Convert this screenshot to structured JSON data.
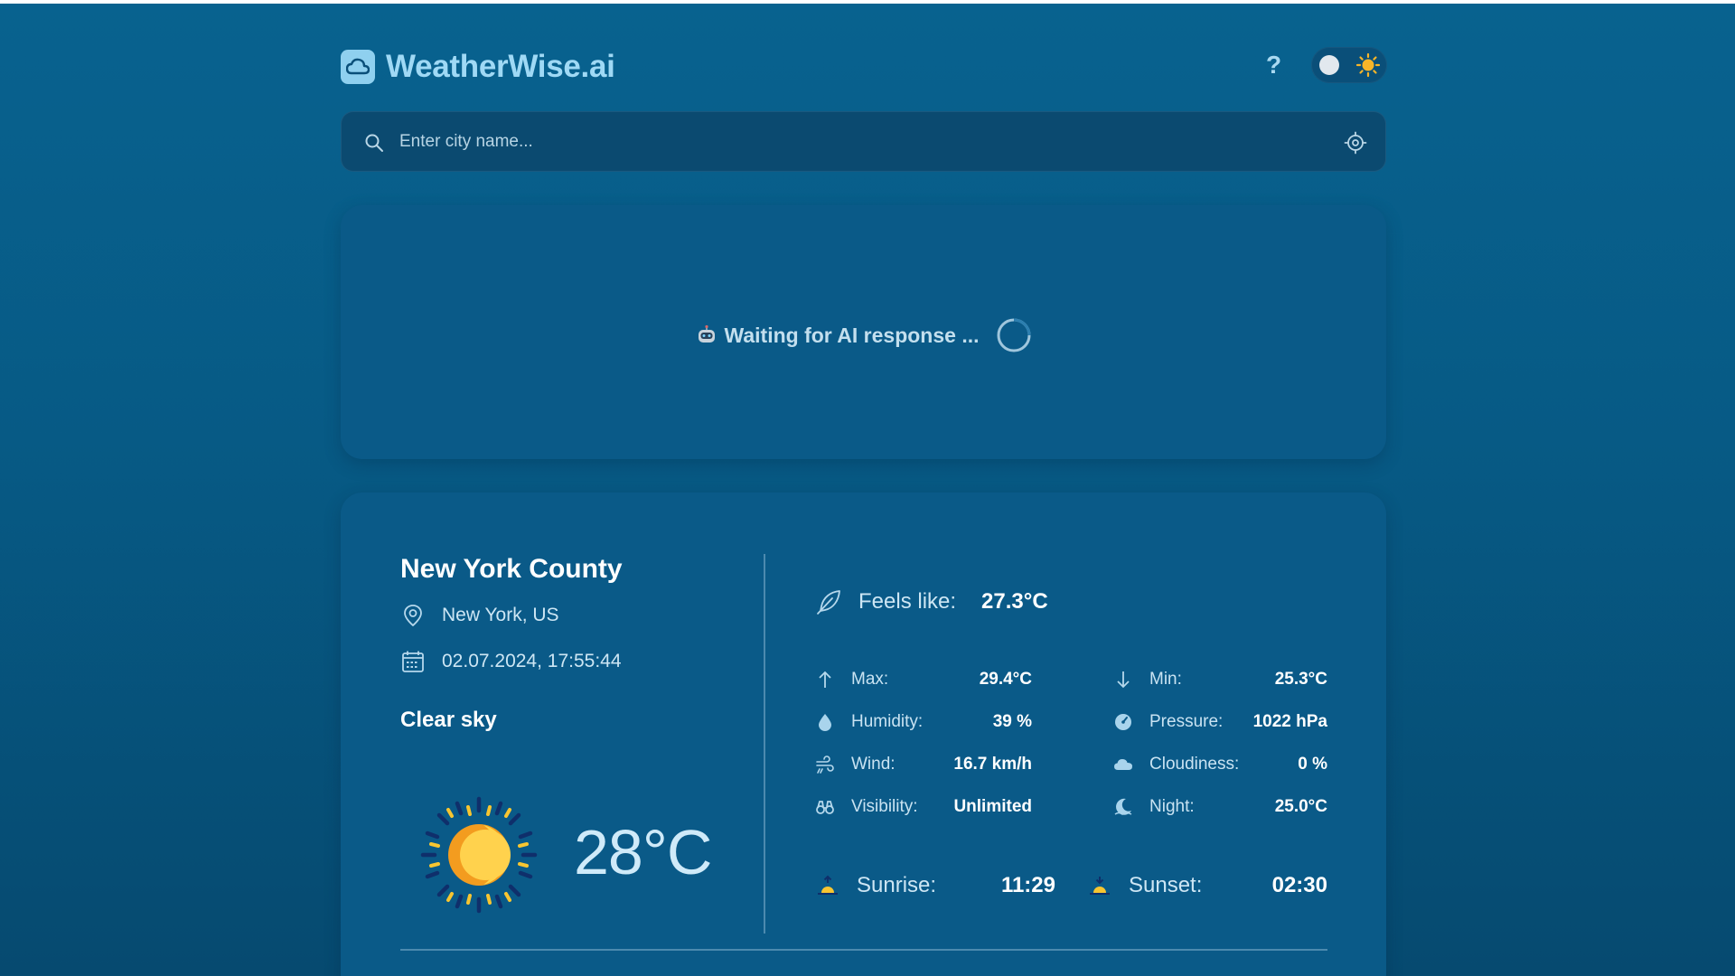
{
  "app": {
    "name": "WeatherWise.ai"
  },
  "header": {
    "help_label": "?"
  },
  "search": {
    "placeholder": "Enter city name..."
  },
  "ai": {
    "status_text": "Waiting for AI response ..."
  },
  "weather": {
    "city": "New York County",
    "location": "New York, US",
    "datetime": "02.07.2024, 17:55:44",
    "condition": "Clear sky",
    "temperature": "28°C",
    "feels_like_label": "Feels like:",
    "feels_like_value": "27.3°C",
    "stats": {
      "max": {
        "label": "Max:",
        "value": "29.4°C",
        "icon": "arrow-up-icon"
      },
      "min": {
        "label": "Min:",
        "value": "25.3°C",
        "icon": "arrow-down-icon"
      },
      "humidity": {
        "label": "Humidity:",
        "value": "39 %",
        "icon": "droplet-icon"
      },
      "pressure": {
        "label": "Pressure:",
        "value": "1022 hPa",
        "icon": "gauge-icon"
      },
      "wind": {
        "label": "Wind:",
        "value": "16.7 km/h",
        "icon": "wind-icon"
      },
      "cloudiness": {
        "label": "Cloudiness:",
        "value": "0 %",
        "icon": "cloud-icon"
      },
      "visibility": {
        "label": "Visibility:",
        "value": "Unlimited",
        "icon": "binoculars-icon"
      },
      "night": {
        "label": "Night:",
        "value": "25.0°C",
        "icon": "moon-icon"
      }
    },
    "sunrise_label": "Sunrise:",
    "sunrise_value": "11:29",
    "sunset_label": "Sunset:",
    "sunset_value": "02:30"
  },
  "colors": {
    "background": "#075a85",
    "card": "#0a5a88",
    "accent": "#9fd9f5",
    "sun_orange": "#f5a623",
    "sun_yellow": "#ffd54a"
  }
}
